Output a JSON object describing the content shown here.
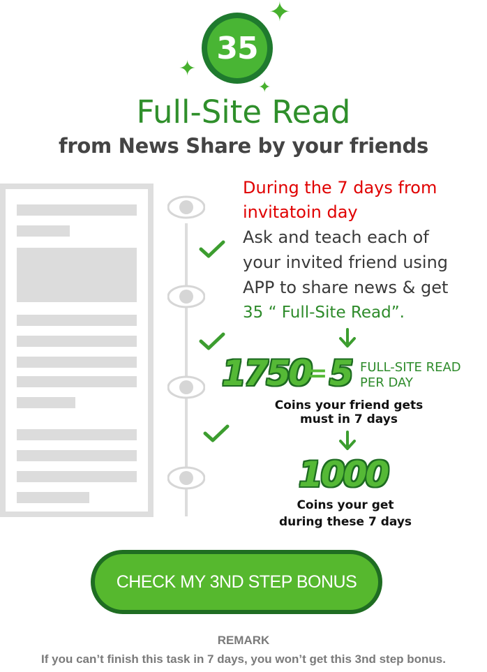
{
  "badge": {
    "number": "35"
  },
  "header": {
    "title": "Full-Site Read",
    "subtitle": "from News Share by your friends"
  },
  "instructions": {
    "red_lines": [
      "During the 7 days from",
      "invitatoin day"
    ],
    "dark_lines": [
      "Ask and teach each of",
      "your invited friend using",
      "APP to share news & get"
    ],
    "green_line": "35 “ Full-Site Read”."
  },
  "equation": {
    "coins": "1750",
    "equals": "=",
    "reads": "5",
    "unit_line1": "FULL-SITE READ",
    "unit_line2": "PER DAY",
    "caption_line1": "Coins your friend gets",
    "caption_line2": "must in 7 days"
  },
  "reward": {
    "coins": "1000",
    "caption_line1": "Coins your get",
    "caption_line2": "during these 7 days"
  },
  "cta": {
    "label": "CHECK MY 3ND STEP BONUS"
  },
  "remark": {
    "title": "REMARK",
    "text": "If you can’t finish this task in 7 days, you won’t get this 3nd step bonus."
  },
  "colors": {
    "accent_green": "#49b534",
    "dark_green": "#1f6d22",
    "title_green": "#2f8f2b",
    "alert_red": "#e00000",
    "doc_grey": "#dcdcdc"
  },
  "icons": [
    "sparkle-icon",
    "eye-icon",
    "check-icon",
    "arrow-down-icon",
    "document-illustration"
  ]
}
